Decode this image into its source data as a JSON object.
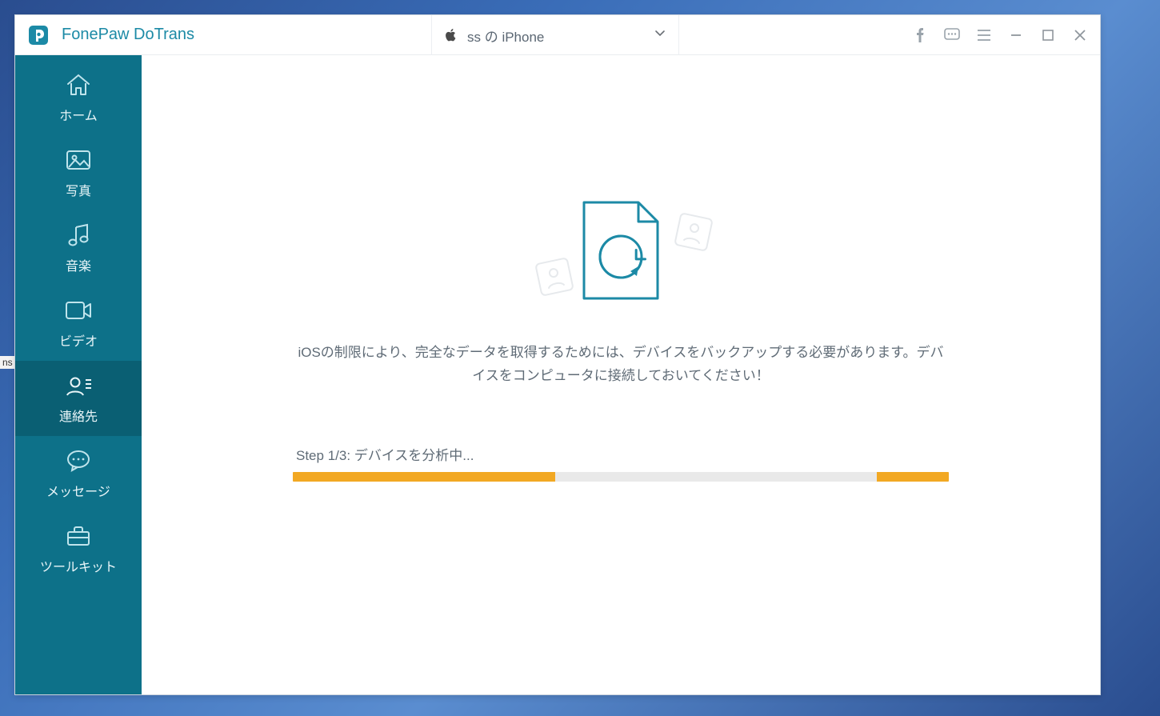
{
  "desktop": {
    "stray_text": "ns"
  },
  "app": {
    "title": "FonePaw DoTrans",
    "device": {
      "name": "ss の iPhone"
    }
  },
  "sidebar": {
    "items": [
      {
        "key": "home",
        "label": "ホーム",
        "icon": "home-icon"
      },
      {
        "key": "photos",
        "label": "写真",
        "icon": "picture-icon"
      },
      {
        "key": "music",
        "label": "音楽",
        "icon": "music-icon"
      },
      {
        "key": "video",
        "label": "ビデオ",
        "icon": "video-icon"
      },
      {
        "key": "contacts",
        "label": "連絡先",
        "icon": "contacts-icon"
      },
      {
        "key": "messages",
        "label": "メッセージ",
        "icon": "message-icon"
      },
      {
        "key": "toolkit",
        "label": "ツールキット",
        "icon": "toolkit-icon"
      }
    ],
    "active_key": "contacts"
  },
  "main": {
    "info_text": "iOSの制限により、完全なデータを取得するためには、デバイスをバックアップする必要があります。デバイスをコンピュータに接続しておいてください！",
    "step_label": "Step 1/3: デバイスを分析中...",
    "progress": {
      "left_pct": 40,
      "right_pct": 11
    }
  }
}
